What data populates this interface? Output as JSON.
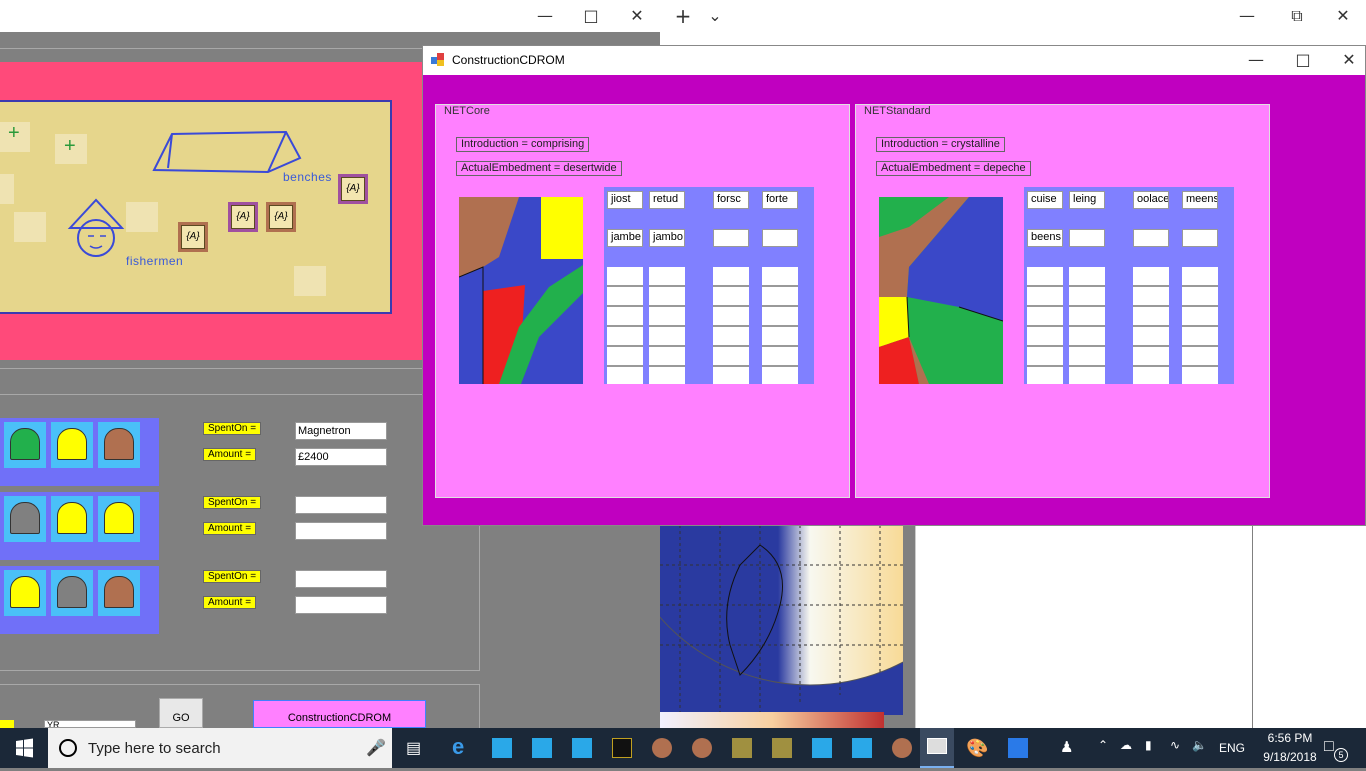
{
  "background_window": {
    "map": {
      "benches_label": "benches",
      "fishermen_label": "fishermen",
      "tag_text": "{A}"
    },
    "rows": [
      {
        "spent_label": "SpentOn =",
        "amount_label": "Amount =",
        "spent_value": "Magnetron",
        "amount_value": "£2400",
        "hats": [
          "#22b04c",
          "#ffff00",
          "#b07050"
        ]
      },
      {
        "spent_label": "SpentOn =",
        "amount_label": "Amount =",
        "spent_value": "",
        "amount_value": "",
        "hats": [
          "#808080",
          "#ffff00",
          "#ffff00"
        ]
      },
      {
        "spent_label": "SpentOn =",
        "amount_label": "Amount =",
        "spent_value": "",
        "amount_value": "",
        "hats": [
          "#ffff00",
          "#808080",
          "#b07050"
        ]
      }
    ],
    "go_label": "GO",
    "open_button_label": "ConstructionCDROM",
    "partial_input_value": "YR"
  },
  "dialog": {
    "title": "ConstructionCDROM",
    "panels": [
      {
        "group_label": "NETCore",
        "introduction": "Introduction = comprising",
        "embedment": "ActualEmbedment = desertwide",
        "row1": [
          "jiost",
          "retud",
          "forsc",
          "forte"
        ],
        "row2": [
          "jambe",
          "jambo",
          "",
          ""
        ]
      },
      {
        "group_label": "NETStandard",
        "introduction": "Introduction = crystalline",
        "embedment": "ActualEmbedment = depeche",
        "row1": [
          "cuise",
          "leing",
          "oolace",
          "meens"
        ],
        "row2": [
          "beens",
          "",
          "",
          ""
        ]
      }
    ]
  },
  "taskbar": {
    "search_placeholder": "Type here to search",
    "language": "ENG",
    "time": "6:56 PM",
    "date": "9/18/2018",
    "notification_count": "5"
  },
  "colors": {
    "dialog_bg": "#c000c0",
    "panel_bg": "#ff80ff",
    "grid_bg": "#8080ff",
    "map_frame": "#ff4a7a",
    "label_yellow": "#ffff00"
  }
}
